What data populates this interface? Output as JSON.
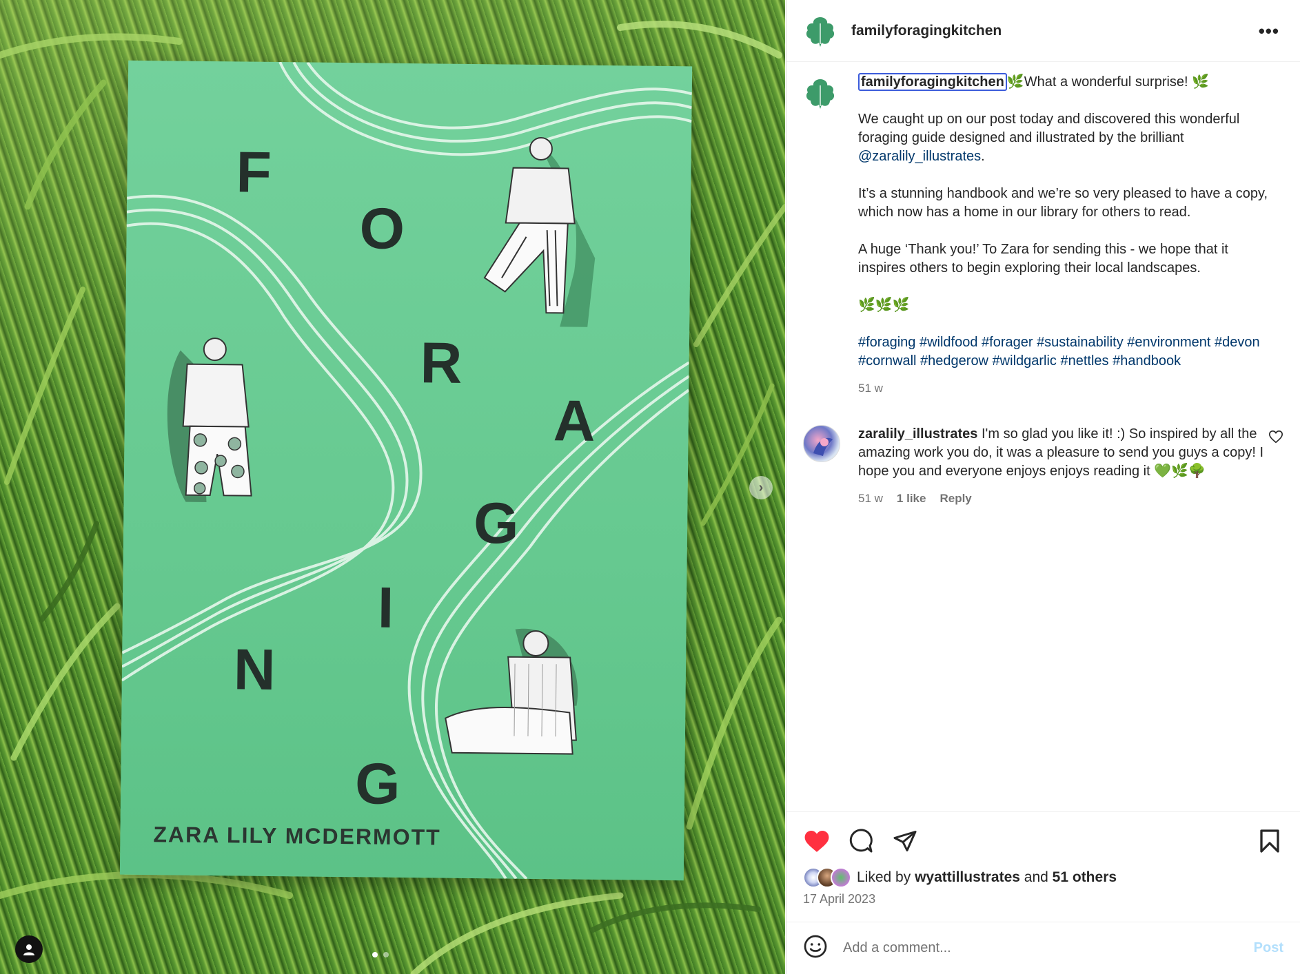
{
  "post": {
    "author": "familyforagingkitchen",
    "more_label": "•••"
  },
  "image": {
    "book_letters": [
      "F",
      "O",
      "R",
      "A",
      "G",
      "I",
      "N",
      "G"
    ],
    "book_author": "ZARA LILY MCDERMOTT",
    "next_arrow": "›"
  },
  "caption": {
    "username": "familyforagingkitchen",
    "line1": "🌿What a wonderful surprise! 🌿",
    "para2_a": "We caught up on our post today and discovered this wonderful foraging guide designed and illustrated by the brilliant ",
    "para2_mention": "@zaralily_illustrates",
    "para2_b": ".",
    "para3": "It’s a stunning handbook and we’re so very pleased to have a copy, which now has a home in our library for others to read.",
    "para4": "A huge ‘Thank you!’ To Zara for sending this - we hope that it inspires others to begin exploring their local landscapes.",
    "para5": "🌿🌿🌿",
    "hashtags": "#foraging #wildfood #forager #sustainability #environment #devon #cornwall #hedgerow #wildgarlic #nettles #handbook",
    "time": "51 w"
  },
  "reply": {
    "username": "zaralily_illustrates",
    "text": " I'm so glad you like it! :) So inspired by all the amazing work you do, it was a pleasure to send you guys a copy! I hope you and everyone enjoys enjoys reading it 💚🌿🌳",
    "time": "51 w",
    "likes": "1 like",
    "reply_label": "Reply"
  },
  "likes": {
    "prefix": "Liked by ",
    "user": "wyattillustrates",
    "middle": " and ",
    "others": "51 others"
  },
  "date": "17 April 2023",
  "add_comment": {
    "placeholder": "Add a comment...",
    "post_label": "Post"
  },
  "colors": {
    "heart": "#ff3040",
    "link": "#00376b",
    "post_disabled": "#b2dffc",
    "book_green": "#6fcf97"
  },
  "icons": [
    "heart-icon",
    "comment-icon",
    "share-icon",
    "bookmark-icon",
    "emoji-icon",
    "more-icon",
    "chevron-right-icon",
    "user-tag-icon",
    "like-outline-icon"
  ]
}
